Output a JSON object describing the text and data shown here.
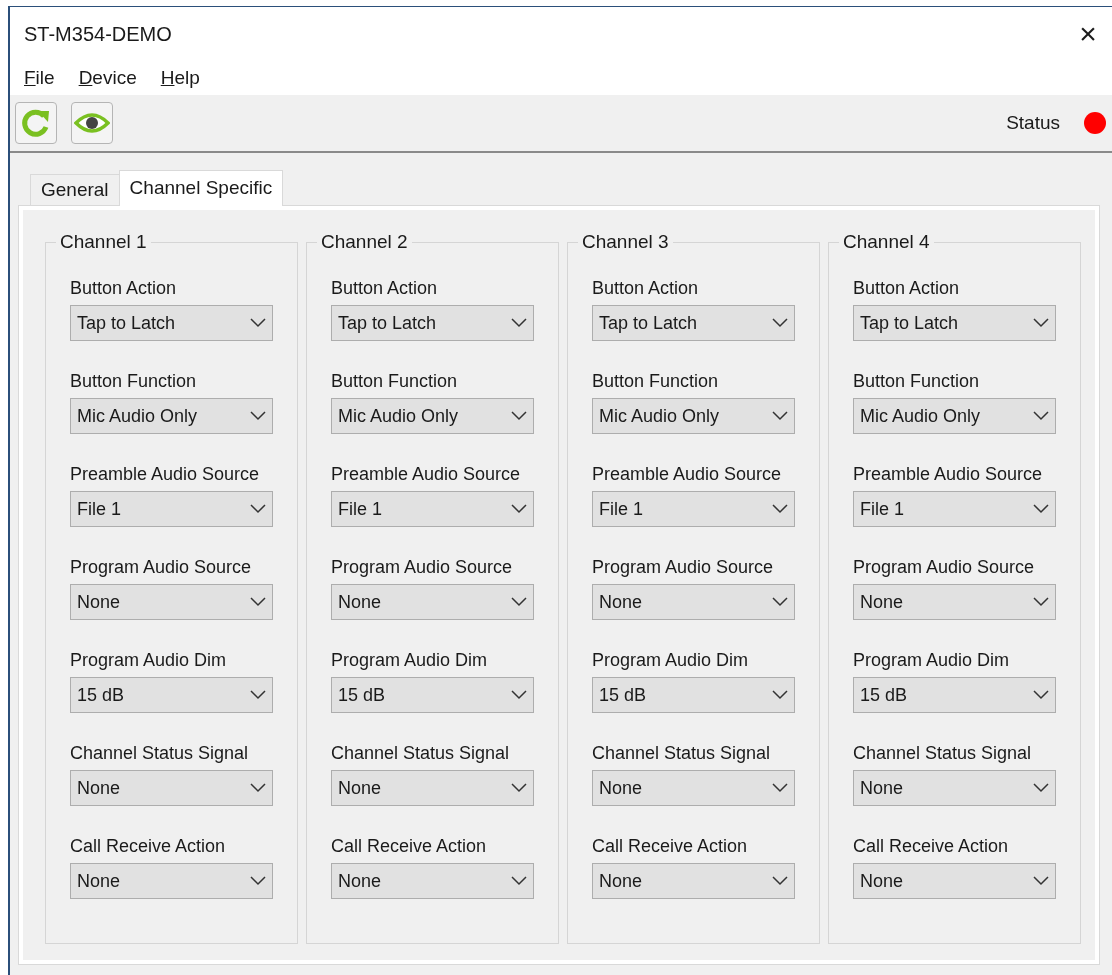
{
  "window": {
    "title": "ST-M354-DEMO",
    "close": "×"
  },
  "menu": [
    "File",
    "Device",
    "Help"
  ],
  "toolbar": {
    "status_label": "Status",
    "connected": false
  },
  "tabs": [
    {
      "label": "General",
      "selected": false
    },
    {
      "label": "Channel Specific",
      "selected": true
    }
  ],
  "channels": [
    {
      "title": "Channel 1",
      "fields": [
        {
          "label": "Button Action",
          "value": "Tap to Latch"
        },
        {
          "label": "Button Function",
          "value": "Mic Audio Only"
        },
        {
          "label": "Preamble Audio Source",
          "value": "File 1"
        },
        {
          "label": "Program Audio Source",
          "value": "None"
        },
        {
          "label": "Program Audio Dim",
          "value": "15 dB"
        },
        {
          "label": "Channel Status Signal",
          "value": "None"
        },
        {
          "label": "Call Receive Action",
          "value": "None"
        }
      ]
    },
    {
      "title": "Channel 2",
      "fields": [
        {
          "label": "Button Action",
          "value": "Tap to Latch"
        },
        {
          "label": "Button Function",
          "value": "Mic Audio Only"
        },
        {
          "label": "Preamble Audio Source",
          "value": "File 1"
        },
        {
          "label": "Program Audio Source",
          "value": "None"
        },
        {
          "label": "Program Audio Dim",
          "value": "15 dB"
        },
        {
          "label": "Channel Status Signal",
          "value": "None"
        },
        {
          "label": "Call Receive Action",
          "value": "None"
        }
      ]
    },
    {
      "title": "Channel 3",
      "fields": [
        {
          "label": "Button Action",
          "value": "Tap to Latch"
        },
        {
          "label": "Button Function",
          "value": "Mic Audio Only"
        },
        {
          "label": "Preamble Audio Source",
          "value": "File 1"
        },
        {
          "label": "Program Audio Source",
          "value": "None"
        },
        {
          "label": "Program Audio Dim",
          "value": "15 dB"
        },
        {
          "label": "Channel Status Signal",
          "value": "None"
        },
        {
          "label": "Call Receive Action",
          "value": "None"
        }
      ]
    },
    {
      "title": "Channel 4",
      "fields": [
        {
          "label": "Button Action",
          "value": "Tap to Latch"
        },
        {
          "label": "Button Function",
          "value": "Mic Audio Only"
        },
        {
          "label": "Preamble Audio Source",
          "value": "File 1"
        },
        {
          "label": "Program Audio Source",
          "value": "None"
        },
        {
          "label": "Program Audio Dim",
          "value": "15 dB"
        },
        {
          "label": "Channel Status Signal",
          "value": "None"
        },
        {
          "label": "Call Receive Action",
          "value": "None"
        }
      ]
    }
  ]
}
